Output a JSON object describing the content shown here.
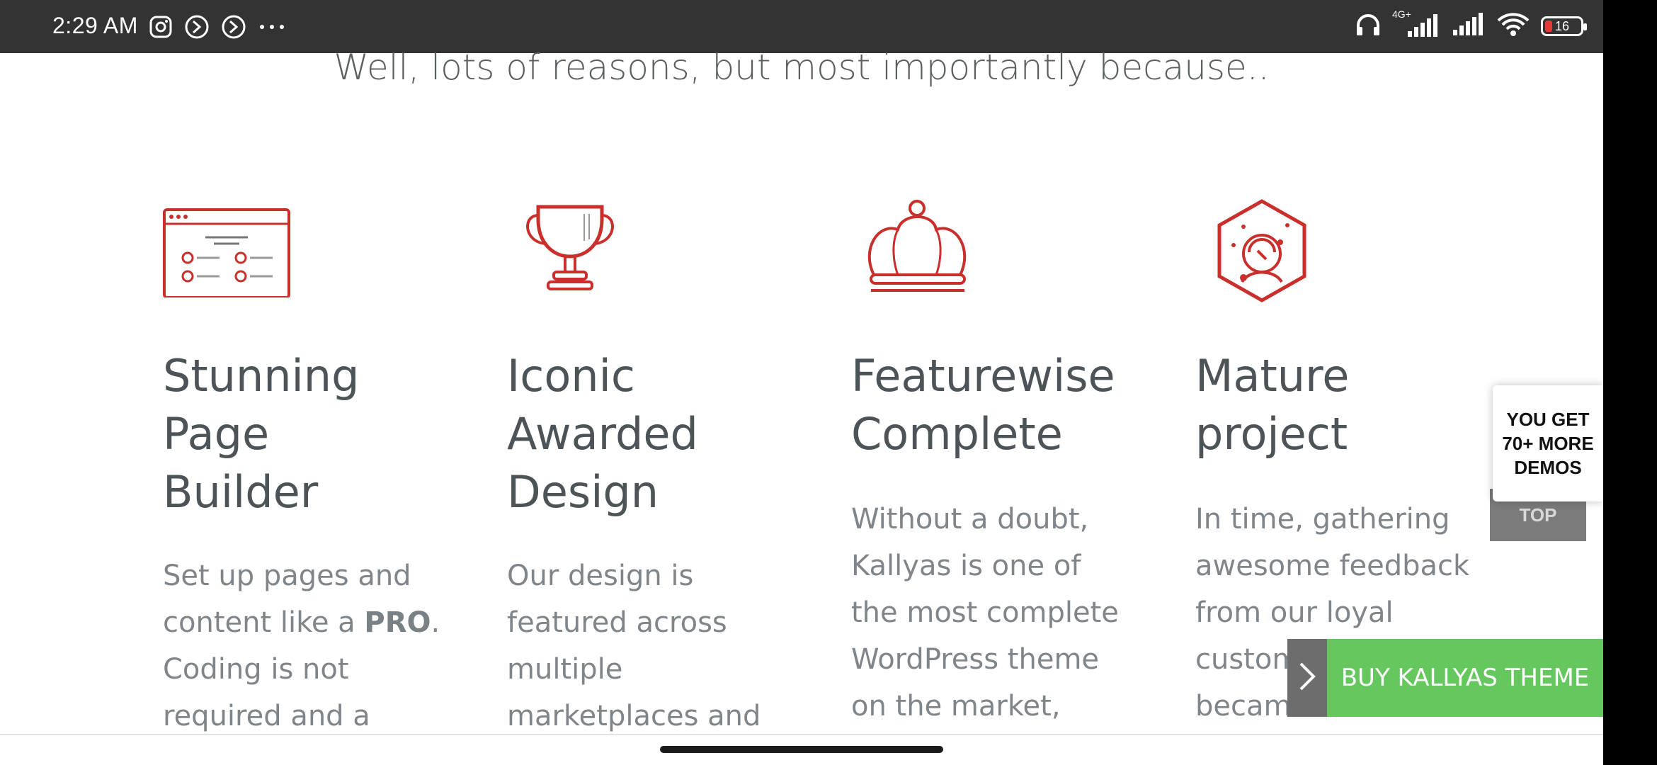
{
  "status_bar": {
    "time": "2:29 AM",
    "icons_left": [
      "instagram-icon",
      "share-arrow-icon",
      "share-arrow-icon",
      "more-dots-icon"
    ],
    "icons_right": [
      "headphones-icon",
      "network-4g-signal-icon",
      "signal-icon",
      "wifi-icon",
      "battery-icon"
    ],
    "network_label": "4G+",
    "battery_level": "16",
    "battery_color": "#e53935"
  },
  "main": {
    "lead_text": "Well, lots of reasons, but most importantly because..",
    "features": [
      {
        "icon": "page-builder-icon",
        "title_lines": [
          "Stunning",
          "Page",
          "Builder"
        ],
        "desc_lines": [
          "Set up pages and",
          "content like a ",
          "PRO",
          ".",
          "Coding is not",
          "required and a"
        ]
      },
      {
        "icon": "trophy-icon",
        "title_lines": [
          "Iconic",
          "Awarded",
          "Design"
        ],
        "desc_lines": [
          "Our design is",
          "featured across",
          "multiple",
          "marketplaces and"
        ]
      },
      {
        "icon": "crown-icon",
        "title_lines": [
          "Featurewise",
          "Complete"
        ],
        "desc_lines": [
          "Without a doubt,",
          "Kallyas is one of",
          "the most complete",
          "WordPress theme",
          "on the market,"
        ]
      },
      {
        "icon": "astronaut-hexagon-icon",
        "title_lines": [
          "Mature",
          "project"
        ],
        "desc_lines": [
          "In time, gathering",
          "awesome feedback",
          "from our loyal",
          "customers",
          "became a"
        ]
      }
    ]
  },
  "widgets": {
    "demos_line1": "YOU GET",
    "demos_line2": "70+ MORE",
    "demos_line3": "DEMOS",
    "to_top_label": "TOP",
    "buy_label": "BUY KALLYAS THEME",
    "buy_color": "#66c75f",
    "arrow_icon": "chevron-right-icon"
  },
  "accent_color": "#c9302c"
}
